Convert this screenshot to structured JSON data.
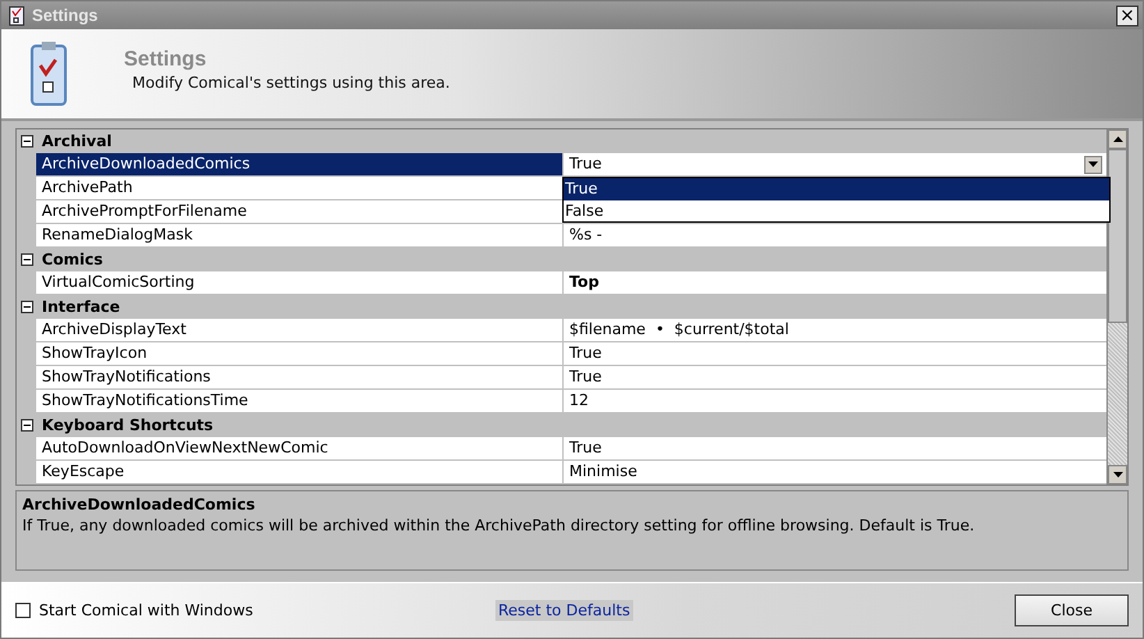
{
  "window": {
    "title": "Settings",
    "close": "×"
  },
  "header": {
    "title": "Settings",
    "subtitle": "Modify Comical's settings using this area."
  },
  "grid": {
    "categories": [
      {
        "name": "Archival",
        "expanded": true,
        "items": [
          {
            "name": "ArchiveDownloadedComics",
            "value": "True",
            "selected": true
          },
          {
            "name": "ArchivePath",
            "selected": false
          },
          {
            "name": "ArchivePromptForFilename",
            "selected": false
          },
          {
            "name": "RenameDialogMask",
            "value": "%s -",
            "selected": false
          }
        ]
      },
      {
        "name": "Comics",
        "expanded": true,
        "items": [
          {
            "name": "VirtualComicSorting",
            "value": "Top",
            "selected": false,
            "bold": true
          }
        ]
      },
      {
        "name": "Interface",
        "expanded": true,
        "items": [
          {
            "name": "ArchiveDisplayText",
            "value": "$filename  •  $current/$total",
            "selected": false
          },
          {
            "name": "ShowTrayIcon",
            "value": "True",
            "selected": false
          },
          {
            "name": "ShowTrayNotifications",
            "value": "True",
            "selected": false
          },
          {
            "name": "ShowTrayNotificationsTime",
            "value": "12",
            "selected": false
          }
        ]
      },
      {
        "name": "Keyboard Shortcuts",
        "expanded": true,
        "items": [
          {
            "name": "AutoDownloadOnViewNextNewComic",
            "value": "True",
            "selected": false
          },
          {
            "name": "KeyEscape",
            "value": "Minimise",
            "selected": false
          }
        ]
      }
    ],
    "dropdown": {
      "options": [
        {
          "label": "True",
          "selected": true
        },
        {
          "label": "False",
          "selected": false
        }
      ]
    }
  },
  "description": {
    "title": "ArchiveDownloadedComics",
    "text": "If True, any downloaded comics will be archived within the ArchivePath directory setting for offline browsing. Default is True."
  },
  "footer": {
    "start_with_windows": {
      "label": "Start Comical with Windows",
      "checked": false
    },
    "reset_link": "Reset to Defaults",
    "close_button": "Close"
  }
}
